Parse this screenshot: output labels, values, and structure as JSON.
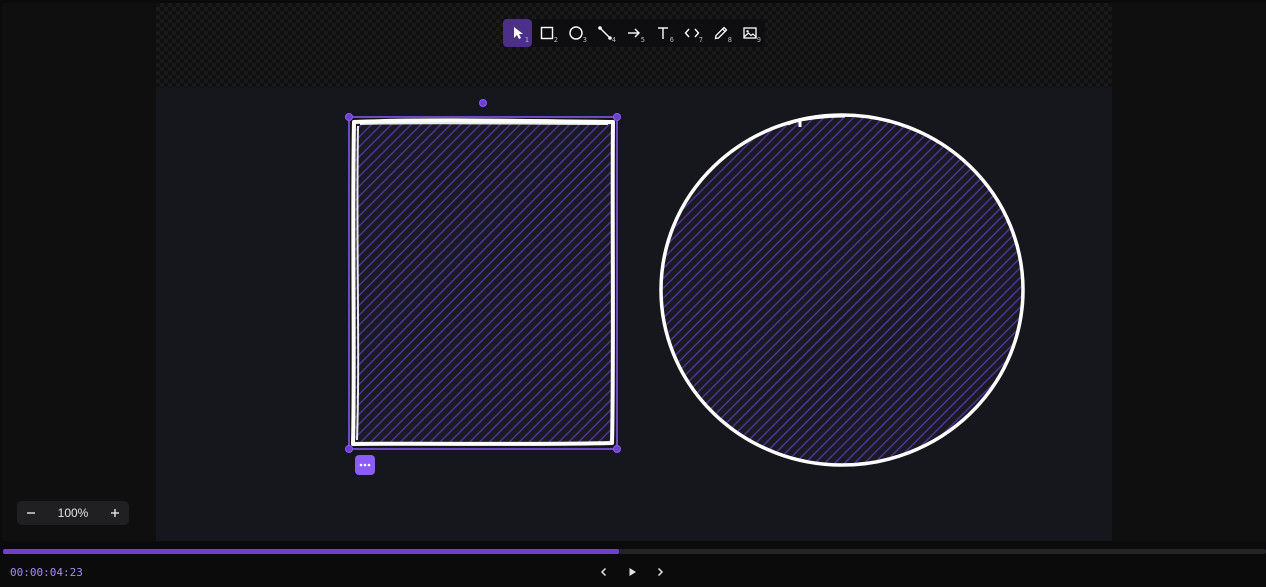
{
  "toolbar": {
    "tools": [
      {
        "name": "select",
        "icon": "cursor-icon",
        "key": "1",
        "active": true
      },
      {
        "name": "rectangle",
        "icon": "rectangle-icon",
        "key": "2"
      },
      {
        "name": "ellipse",
        "icon": "ellipse-icon",
        "key": "3"
      },
      {
        "name": "line",
        "icon": "line-icon",
        "key": "4"
      },
      {
        "name": "arrow",
        "icon": "arrow-icon",
        "key": "5"
      },
      {
        "name": "text",
        "icon": "text-icon",
        "key": "6"
      },
      {
        "name": "code",
        "icon": "code-icon",
        "key": "7"
      },
      {
        "name": "pencil",
        "icon": "pencil-icon",
        "key": "8"
      },
      {
        "name": "image",
        "icon": "image-icon",
        "key": "9"
      }
    ]
  },
  "zoom": {
    "level": "100%"
  },
  "timeline": {
    "time": "00:00:04:23",
    "progress": 0.488
  },
  "colors": {
    "accent": "#8b5cf6",
    "active_tool": "#4c2f88",
    "timeline_fill": "#6d3fd3",
    "time_text": "#a78bfa",
    "hatch": "#4f3391",
    "stroke": "#ffffff"
  }
}
